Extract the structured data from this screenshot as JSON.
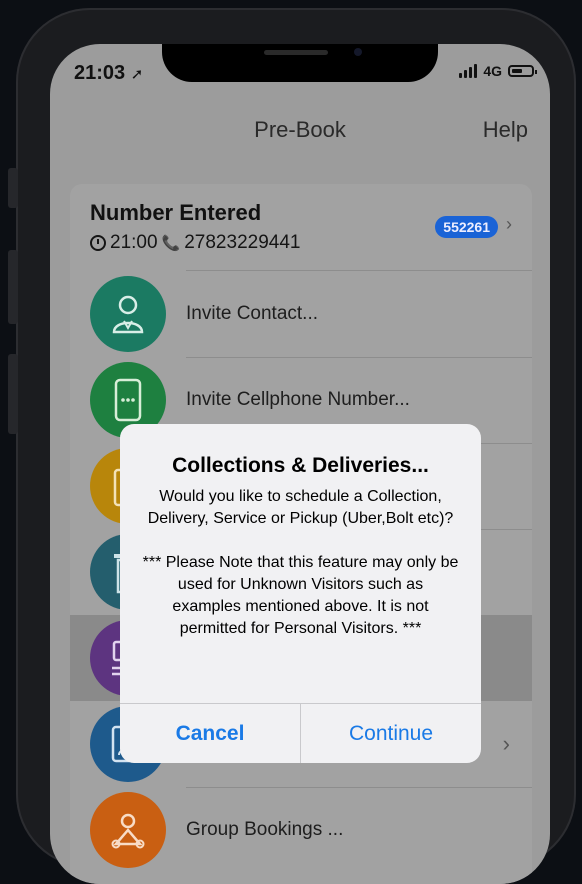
{
  "status_bar": {
    "time": "21:03",
    "network": "4G"
  },
  "nav": {
    "title": "Pre-Book",
    "help_label": "Help"
  },
  "card": {
    "title": "Number Entered",
    "time": "21:00",
    "phone": "27823229441",
    "code_badge": "552261"
  },
  "rows": [
    {
      "label": "Invite Contact...",
      "icon": "person-icon",
      "color": "#1b7a62"
    },
    {
      "label": "Invite Cellphone Number...",
      "icon": "cellphone-icon",
      "color": "#1e8040"
    },
    {
      "label": "",
      "icon": "clipboard-icon",
      "color": "#b8860b"
    },
    {
      "label": "",
      "icon": "trash-icon",
      "color": "#245e6d"
    },
    {
      "label": "",
      "icon": "delivery-icon",
      "color": "#5d3480"
    },
    {
      "label": "",
      "icon": "id-card-icon",
      "color": "#1e5a8c"
    },
    {
      "label": "Group Bookings ...",
      "icon": "group-icon",
      "color": "#c95f12"
    }
  ],
  "dialog": {
    "title": "Collections & Deliveries...",
    "message": "Would you like to schedule a Collection, Delivery, Service or Pickup (Uber,Bolt etc)?",
    "note": "*** Please Note that this feature may only be used for Unknown Visitors such as examples mentioned above. It is not permitted for Personal Visitors. ***",
    "cancel_label": "Cancel",
    "continue_label": "Continue"
  },
  "colors": {
    "accent": "#1a7ae6",
    "badge": "#1a63d6"
  }
}
